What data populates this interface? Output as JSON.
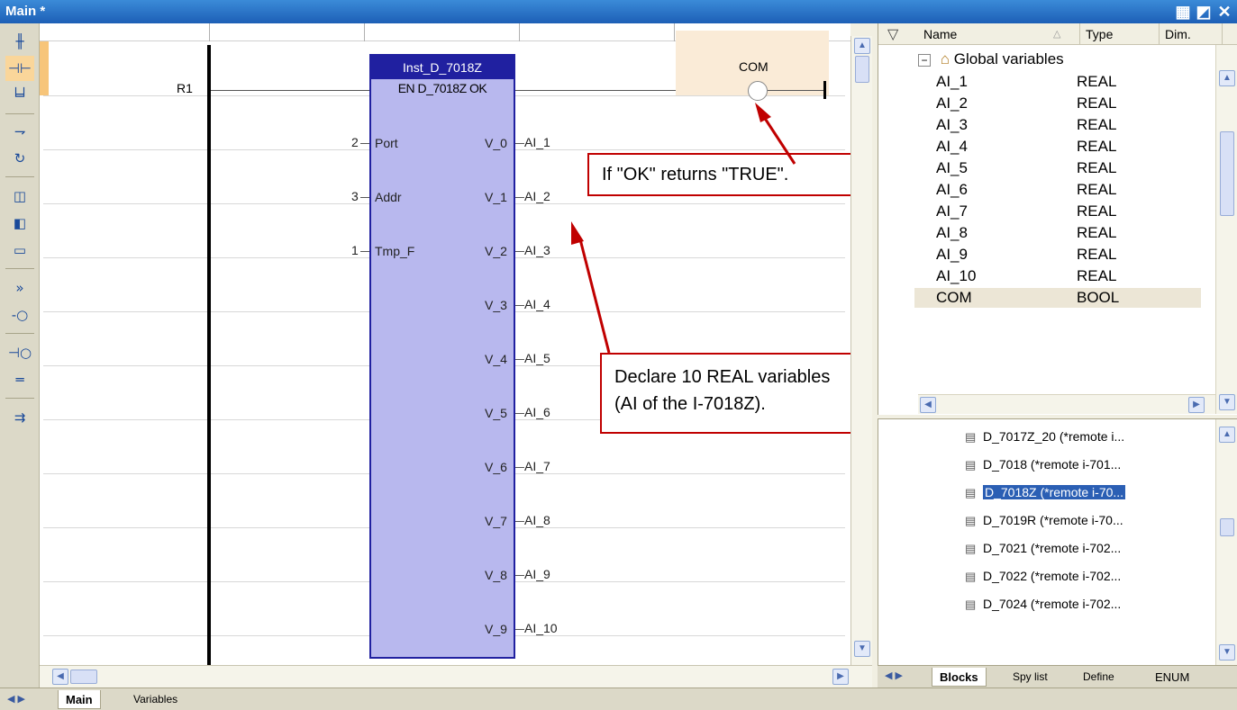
{
  "window": {
    "title": "Main *",
    "buttons": [
      "tile",
      "minimize",
      "close"
    ]
  },
  "toolbar": {
    "icons": [
      "contact-icon",
      "parallel-contact-icon",
      "branch-icon",
      "horizontal-line-icon",
      "return-icon",
      "left-contact-icon",
      "right-contact-icon",
      "block-icon",
      "jump-icon",
      "coil-icon",
      "negated-coil-icon",
      "double-line-icon",
      "comment-icon"
    ]
  },
  "ladder": {
    "rung_label": "R1",
    "block": {
      "instance": "Inst_D_7018Z",
      "type_line": "EN  D_7018Z  OK",
      "inputs": [
        {
          "value": "2",
          "name": "Port"
        },
        {
          "value": "3",
          "name": "Addr"
        },
        {
          "value": "1",
          "name": "Tmp_F"
        }
      ],
      "outputs": [
        {
          "name": "V_0",
          "var": "AI_1"
        },
        {
          "name": "V_1",
          "var": "AI_2"
        },
        {
          "name": "V_2",
          "var": "AI_3"
        },
        {
          "name": "V_3",
          "var": "AI_4"
        },
        {
          "name": "V_4",
          "var": "AI_5"
        },
        {
          "name": "V_5",
          "var": "AI_6"
        },
        {
          "name": "V_6",
          "var": "AI_7"
        },
        {
          "name": "V_7",
          "var": "AI_8"
        },
        {
          "name": "V_8",
          "var": "AI_9"
        },
        {
          "name": "V_9",
          "var": "AI_10"
        }
      ]
    },
    "coil_label": "COM"
  },
  "callouts": {
    "ok": "If \"OK\" returns \"TRUE\".",
    "declare_line1": "Declare 10 REAL variables",
    "declare_line2": "(AI of the I-7018Z)."
  },
  "variables_panel": {
    "headers": {
      "name": "Name",
      "type": "Type",
      "dim": "Dim."
    },
    "group": "Global variables",
    "rows": [
      {
        "name": "AI_1",
        "type": "REAL"
      },
      {
        "name": "AI_2",
        "type": "REAL"
      },
      {
        "name": "AI_3",
        "type": "REAL"
      },
      {
        "name": "AI_4",
        "type": "REAL"
      },
      {
        "name": "AI_5",
        "type": "REAL"
      },
      {
        "name": "AI_6",
        "type": "REAL"
      },
      {
        "name": "AI_7",
        "type": "REAL"
      },
      {
        "name": "AI_8",
        "type": "REAL"
      },
      {
        "name": "AI_9",
        "type": "REAL"
      },
      {
        "name": "AI_10",
        "type": "REAL"
      },
      {
        "name": "COM",
        "type": "BOOL"
      }
    ]
  },
  "blocks_panel": {
    "items": [
      "D_7017Z_20 (*remote i...",
      "D_7018 (*remote i-701...",
      "D_7018Z (*remote i-70...",
      "D_7019R (*remote i-70...",
      "D_7021 (*remote i-702...",
      "D_7022 (*remote i-702...",
      "D_7024 (*remote i-702..."
    ],
    "selected_index": 2,
    "tabs": [
      "Blocks",
      "Spy list",
      "Define",
      "ENUM"
    ]
  },
  "bottom_tabs": [
    "Main",
    "Variables"
  ],
  "colors": {
    "title_bar": "#1d5fb6",
    "block_fill": "#b8b8ee",
    "block_border": "#2020a0",
    "callout_border": "#c00000",
    "selection": "#2b5fb4"
  }
}
